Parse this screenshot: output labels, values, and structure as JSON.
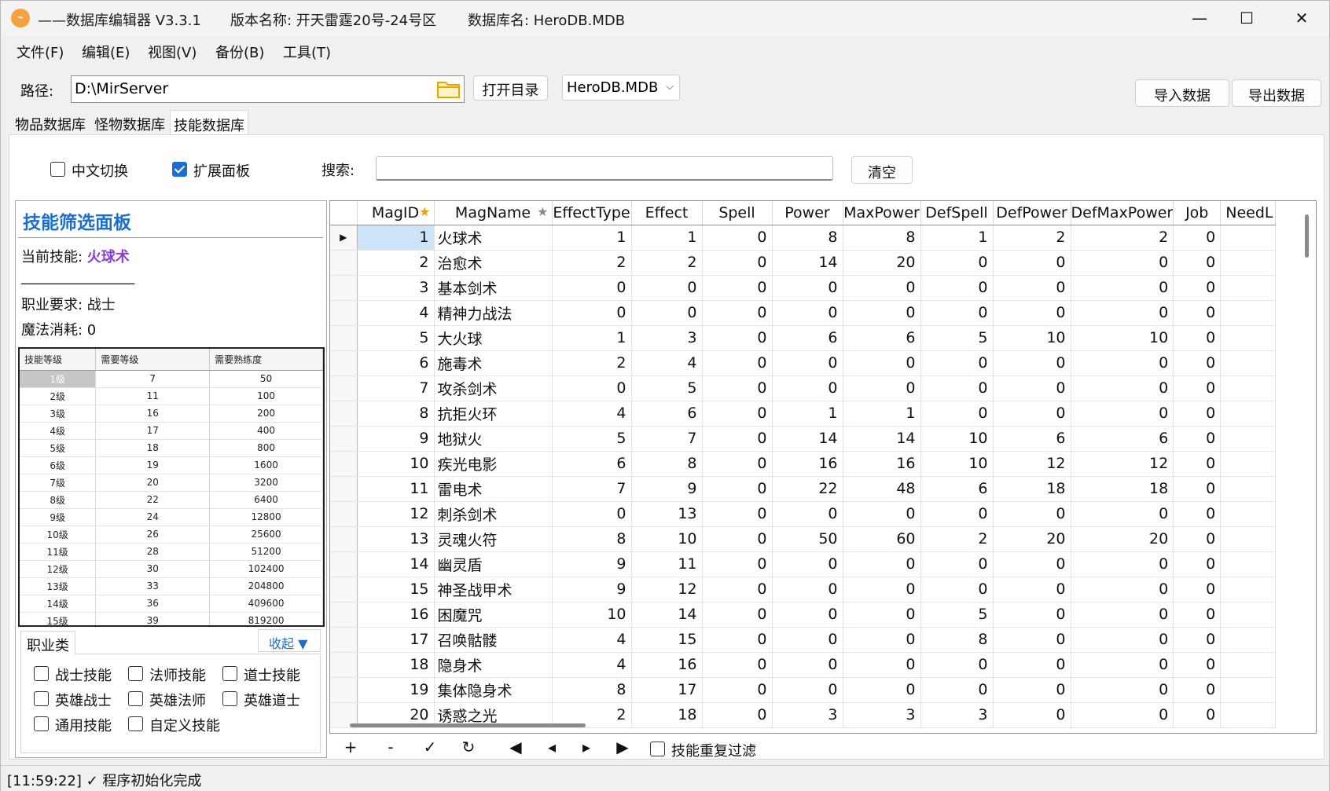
{
  "window": {
    "app_title": "——数据库编辑器 V3.3.1",
    "version_label": "版本名称: 开天雷霆20号-24号区",
    "db_label": "数据库名: HeroDB.MDB",
    "minimize": "—",
    "maximize": "☐",
    "close": "✕"
  },
  "menu": [
    "文件(F)",
    "编辑(E)",
    "视图(V)",
    "备份(B)",
    "工具(T)"
  ],
  "toolbar": {
    "path_label": "路径:",
    "path_value": "D:\\MirServer",
    "open_dir": "打开目录",
    "db_select": "HeroDB.MDB",
    "import": "导入数据",
    "export": "导出数据"
  },
  "tabs": [
    "物品数据库",
    "怪物数据库",
    "技能数据库"
  ],
  "filters": {
    "chinese_toggle": "中文切换",
    "chinese_toggle_checked": false,
    "expand_panel": "扩展面板",
    "expand_panel_checked": true,
    "search_label": "搜索:",
    "search_value": "",
    "clear": "清空"
  },
  "left_panel": {
    "title": "技能筛选面板",
    "current_skill_label": "当前技能: ",
    "current_skill": "火球术",
    "divider_text": "________________",
    "job_req": "职业要求: 战士",
    "mana_cost": "魔法消耗: 0",
    "level_table": {
      "headers": [
        "技能等级",
        "需要等级",
        "需要熟练度"
      ],
      "rows": [
        [
          "1级",
          "7",
          "50"
        ],
        [
          "2级",
          "11",
          "100"
        ],
        [
          "3级",
          "16",
          "200"
        ],
        [
          "4级",
          "17",
          "400"
        ],
        [
          "5级",
          "18",
          "800"
        ],
        [
          "6级",
          "19",
          "1600"
        ],
        [
          "7级",
          "20",
          "3200"
        ],
        [
          "8级",
          "22",
          "6400"
        ],
        [
          "9级",
          "24",
          "12800"
        ],
        [
          "10级",
          "26",
          "25600"
        ],
        [
          "11级",
          "28",
          "51200"
        ],
        [
          "12级",
          "30",
          "102400"
        ],
        [
          "13级",
          "33",
          "204800"
        ],
        [
          "14级",
          "36",
          "409600"
        ],
        [
          "15级",
          "39",
          "819200"
        ]
      ]
    },
    "job_tab": "职业类",
    "collapse": "收起 ▼",
    "job_checks": [
      "战士技能",
      "法师技能",
      "道士技能",
      "英雄战士",
      "英雄法师",
      "英雄道士",
      "通用技能",
      "自定义技能"
    ]
  },
  "grid": {
    "columns": [
      "MagID",
      "MagName",
      "EffectType",
      "Effect",
      "Spell",
      "Power",
      "MaxPower",
      "DefSpell",
      "DefPower",
      "DefMaxPower",
      "Job",
      "NeedL"
    ],
    "rows": [
      [
        "1",
        "火球术",
        "1",
        "1",
        "0",
        "8",
        "8",
        "1",
        "2",
        "2",
        "0",
        ""
      ],
      [
        "2",
        "治愈术",
        "2",
        "2",
        "0",
        "14",
        "20",
        "0",
        "0",
        "0",
        "0",
        ""
      ],
      [
        "3",
        "基本剑术",
        "0",
        "0",
        "0",
        "0",
        "0",
        "0",
        "0",
        "0",
        "0",
        ""
      ],
      [
        "4",
        "精神力战法",
        "0",
        "0",
        "0",
        "0",
        "0",
        "0",
        "0",
        "0",
        "0",
        ""
      ],
      [
        "5",
        "大火球",
        "1",
        "3",
        "0",
        "6",
        "6",
        "5",
        "10",
        "10",
        "0",
        ""
      ],
      [
        "6",
        "施毒术",
        "2",
        "4",
        "0",
        "0",
        "0",
        "0",
        "0",
        "0",
        "0",
        ""
      ],
      [
        "7",
        "攻杀剑术",
        "0",
        "5",
        "0",
        "0",
        "0",
        "0",
        "0",
        "0",
        "0",
        ""
      ],
      [
        "8",
        "抗拒火环",
        "4",
        "6",
        "0",
        "1",
        "1",
        "0",
        "0",
        "0",
        "0",
        ""
      ],
      [
        "9",
        "地狱火",
        "5",
        "7",
        "0",
        "14",
        "14",
        "10",
        "6",
        "6",
        "0",
        ""
      ],
      [
        "10",
        "疾光电影",
        "6",
        "8",
        "0",
        "16",
        "16",
        "10",
        "12",
        "12",
        "0",
        ""
      ],
      [
        "11",
        "雷电术",
        "7",
        "9",
        "0",
        "22",
        "48",
        "6",
        "18",
        "18",
        "0",
        ""
      ],
      [
        "12",
        "刺杀剑术",
        "0",
        "13",
        "0",
        "0",
        "0",
        "0",
        "0",
        "0",
        "0",
        ""
      ],
      [
        "13",
        "灵魂火符",
        "8",
        "10",
        "0",
        "50",
        "60",
        "2",
        "20",
        "20",
        "0",
        ""
      ],
      [
        "14",
        "幽灵盾",
        "9",
        "11",
        "0",
        "0",
        "0",
        "0",
        "0",
        "0",
        "0",
        ""
      ],
      [
        "15",
        "神圣战甲术",
        "9",
        "12",
        "0",
        "0",
        "0",
        "0",
        "0",
        "0",
        "0",
        ""
      ],
      [
        "16",
        "困魔咒",
        "10",
        "14",
        "0",
        "0",
        "0",
        "5",
        "0",
        "0",
        "0",
        ""
      ],
      [
        "17",
        "召唤骷髅",
        "4",
        "15",
        "0",
        "0",
        "0",
        "8",
        "0",
        "0",
        "0",
        ""
      ],
      [
        "18",
        "隐身术",
        "4",
        "16",
        "0",
        "0",
        "0",
        "0",
        "0",
        "0",
        "0",
        ""
      ],
      [
        "19",
        "集体隐身术",
        "8",
        "17",
        "0",
        "0",
        "0",
        "0",
        "0",
        "0",
        "0",
        ""
      ],
      [
        "20",
        "诱惑之光",
        "2",
        "18",
        "0",
        "3",
        "3",
        "3",
        "0",
        "0",
        "0",
        ""
      ]
    ]
  },
  "nav": {
    "add": "+",
    "remove": "-",
    "confirm": "✓",
    "refresh": "↻",
    "first": "◀",
    "prev": "◂",
    "next": "▸",
    "last": "▶",
    "dup_filter": "技能重复过滤"
  },
  "status": "[11:59:22] ✓ 程序初始化完成",
  "colors": {
    "accent": "#1a6fd1",
    "purple": "#8a3fd1",
    "selected_cell": "#cce4f7"
  }
}
